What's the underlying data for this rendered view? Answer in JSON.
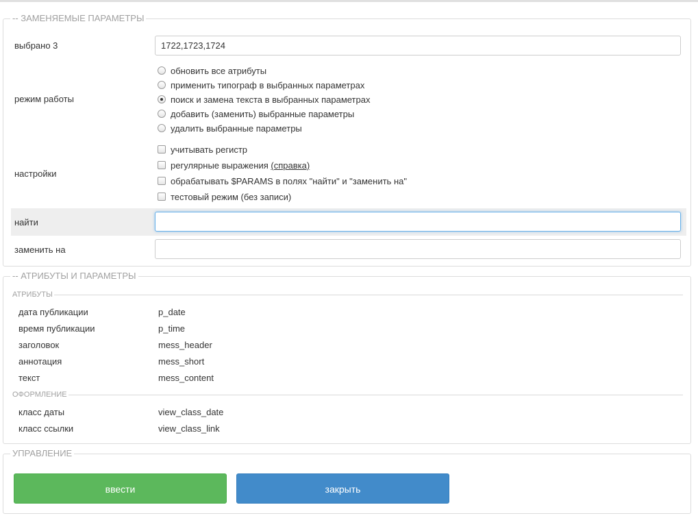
{
  "sections": {
    "replace": {
      "legend": "-- ЗАМЕНЯЕМЫЕ ПАРАМЕТРЫ"
    },
    "attrs": {
      "legend": "-- АТРИБУТЫ И ПАРАМЕТРЫ"
    },
    "control": {
      "legend": "УПРАВЛЕНИЕ"
    }
  },
  "selected": {
    "label": "выбрано 3",
    "value": "1722,1723,1724"
  },
  "mode": {
    "label": "режим работы",
    "options": [
      {
        "label": "обновить все атрибуты",
        "checked": false
      },
      {
        "label": "применить типограф в выбранных параметрах",
        "checked": false
      },
      {
        "label": "поиск и замена текста в выбранных параметрах",
        "checked": true
      },
      {
        "label": "добавить (заменить) выбранные параметры",
        "checked": false
      },
      {
        "label": "удалить выбранные параметры",
        "checked": false
      }
    ]
  },
  "settings": {
    "label": "настройки",
    "case_label": "учитывать регистр",
    "regex_label": "регулярные выражения",
    "regex_help": "(справка)",
    "params_label": "обрабатывать $PARAMS в полях \"найти\" и \"заменить на\"",
    "test_label": "тестовый режим (без записи)"
  },
  "find": {
    "label": "найти",
    "value": ""
  },
  "replace_with": {
    "label": "заменить на",
    "value": ""
  },
  "attributes": {
    "header": "АТРИБУТЫ",
    "rows": [
      {
        "name": "дата публикации",
        "code": "p_date"
      },
      {
        "name": "время публикации",
        "code": "p_time"
      },
      {
        "name": "заголовок",
        "code": "mess_header"
      },
      {
        "name": "аннотация",
        "code": "mess_short"
      },
      {
        "name": "текст",
        "code": "mess_content"
      }
    ]
  },
  "design": {
    "header": "ОФОРМЛЕНИЕ",
    "rows": [
      {
        "name": "класс даты",
        "code": "view_class_date"
      },
      {
        "name": "класс ссылки",
        "code": "view_class_link"
      }
    ]
  },
  "buttons": {
    "submit": "ввести",
    "close": "закрыть"
  },
  "colors": {
    "submit": "#5cb85c",
    "close": "#428bca",
    "legend": "#a0a0a0"
  }
}
